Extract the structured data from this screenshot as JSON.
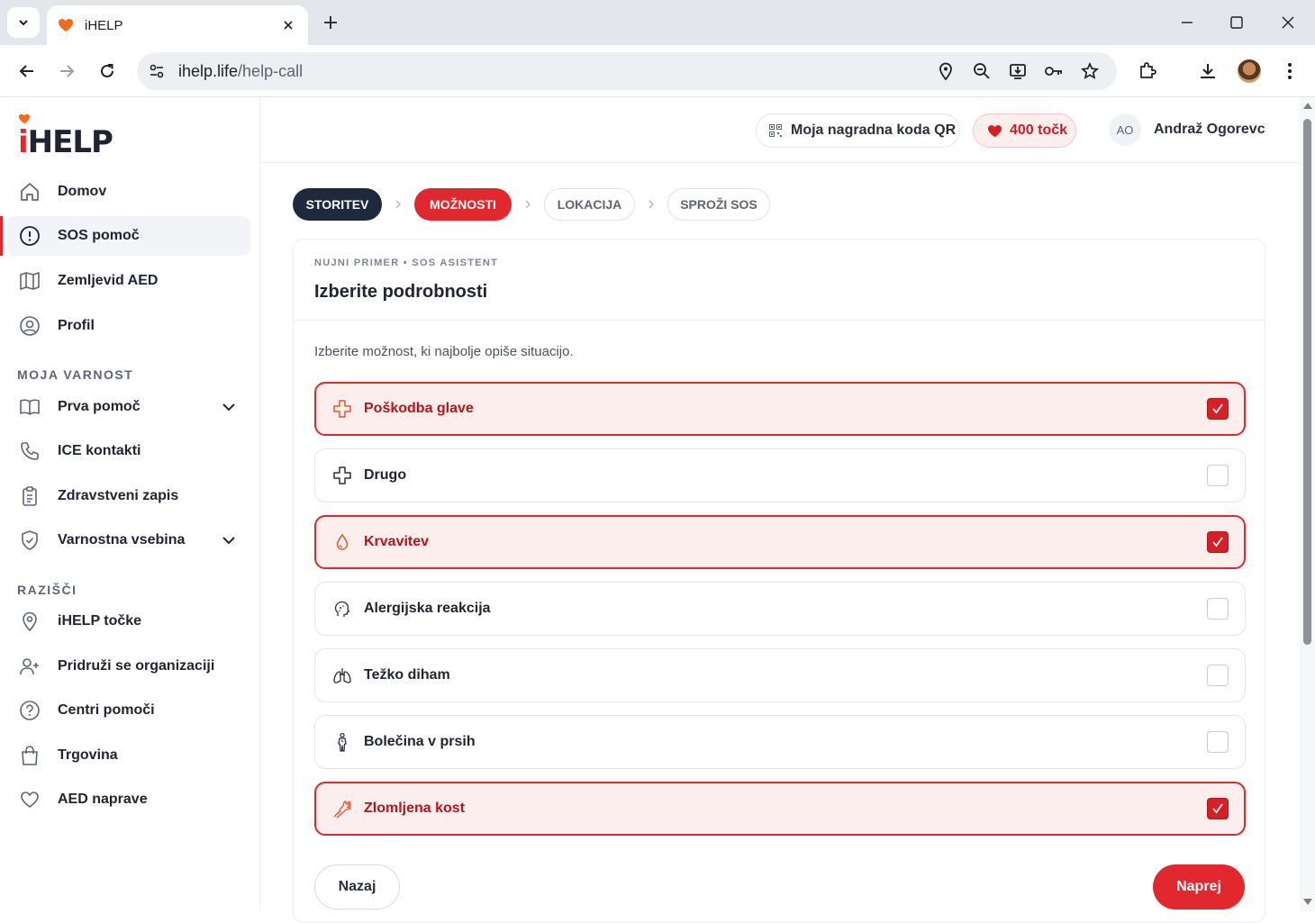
{
  "browser": {
    "tab_title": "iHELP",
    "url_host": "ihelp.life",
    "url_path": "/help-call"
  },
  "sidebar": {
    "logo": "iHELP",
    "items": [
      {
        "label": "Domov",
        "icon": "home-icon"
      },
      {
        "label": "SOS pomoč",
        "icon": "alert-circle-icon",
        "active": true
      },
      {
        "label": "Zemljevid AED",
        "icon": "map-icon"
      },
      {
        "label": "Profil",
        "icon": "user-circle-icon"
      }
    ],
    "section_safety": "MOJA VARNOST",
    "safety_items": [
      {
        "label": "Prva pomoč",
        "icon": "book-icon",
        "expandable": true
      },
      {
        "label": "ICE kontakti",
        "icon": "phone-icon"
      },
      {
        "label": "Zdravstveni zapis",
        "icon": "clipboard-icon"
      },
      {
        "label": "Varnostna vsebina",
        "icon": "shield-icon",
        "expandable": true
      }
    ],
    "section_explore": "RAZIŠČI",
    "explore_items": [
      {
        "label": "iHELP točke",
        "icon": "map-pin-icon"
      },
      {
        "label": "Pridruži se organizaciji",
        "icon": "user-plus-icon"
      },
      {
        "label": "Centri pomoči",
        "icon": "help-circle-icon"
      },
      {
        "label": "Trgovina",
        "icon": "shopping-bag-icon"
      },
      {
        "label": "AED naprave",
        "icon": "heart-icon"
      }
    ]
  },
  "header": {
    "qr_label": "Moja nagradna koda QR",
    "points_label": "400 točk",
    "user_initials": "AO",
    "user_name": "Andraž Ogorevc"
  },
  "steps": [
    "STORITEV",
    "MOŽNOSTI",
    "LOKACIJA",
    "SPROŽI SOS"
  ],
  "card": {
    "eyebrow": "NUJNI PRIMER • SOS ASISTENT",
    "title": "Izberite podrobnosti",
    "instruction": "Izberite možnost, ki najbolje opiše situacijo.",
    "options": [
      {
        "label": "Poškodba glave",
        "icon": "medical-cross-icon",
        "checked": true
      },
      {
        "label": "Drugo",
        "icon": "medical-cross-icon",
        "checked": false
      },
      {
        "label": "Krvavitev",
        "icon": "blood-drop-icon",
        "checked": true
      },
      {
        "label": "Alergijska reakcija",
        "icon": "allergy-face-icon",
        "checked": false
      },
      {
        "label": "Težko diham",
        "icon": "lungs-icon",
        "checked": false
      },
      {
        "label": "Bolečina v prsih",
        "icon": "person-chest-icon",
        "checked": false
      },
      {
        "label": "Zlomljena kost",
        "icon": "broken-arm-icon",
        "checked": true
      }
    ]
  },
  "buttons": {
    "back": "Nazaj",
    "next": "Naprej"
  },
  "colors": {
    "accent": "#e0282e",
    "dark": "#1e2a3b",
    "selected_bg": "#fdeeee"
  }
}
